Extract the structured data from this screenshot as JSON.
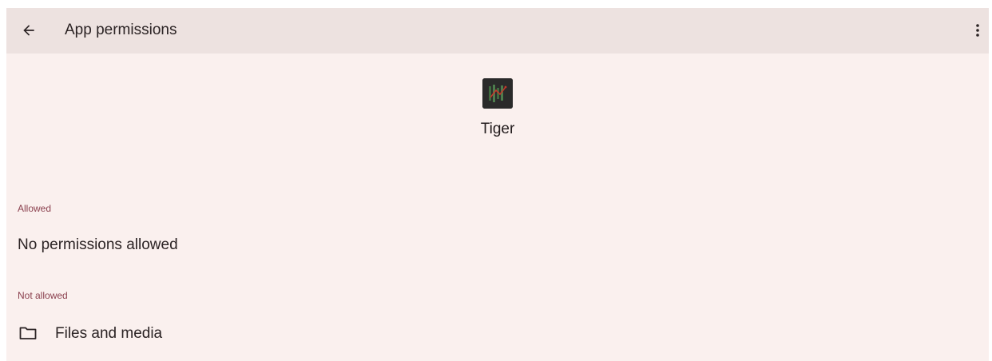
{
  "appbar": {
    "title": "App permissions",
    "back_icon": "arrow-back-icon",
    "overflow_icon": "more-vert-icon"
  },
  "app": {
    "name": "Tiger",
    "icon": "tiger-app-icon"
  },
  "sections": {
    "allowed": {
      "label": "Allowed",
      "empty_text": "No permissions allowed"
    },
    "not_allowed": {
      "label": "Not allowed",
      "items": [
        {
          "label": "Files and media",
          "icon": "folder-icon"
        }
      ]
    }
  },
  "colors": {
    "background": "#faf0ee",
    "appbar": "#ede2e0",
    "accent": "#8a3f4d",
    "text": "#2b2324"
  }
}
